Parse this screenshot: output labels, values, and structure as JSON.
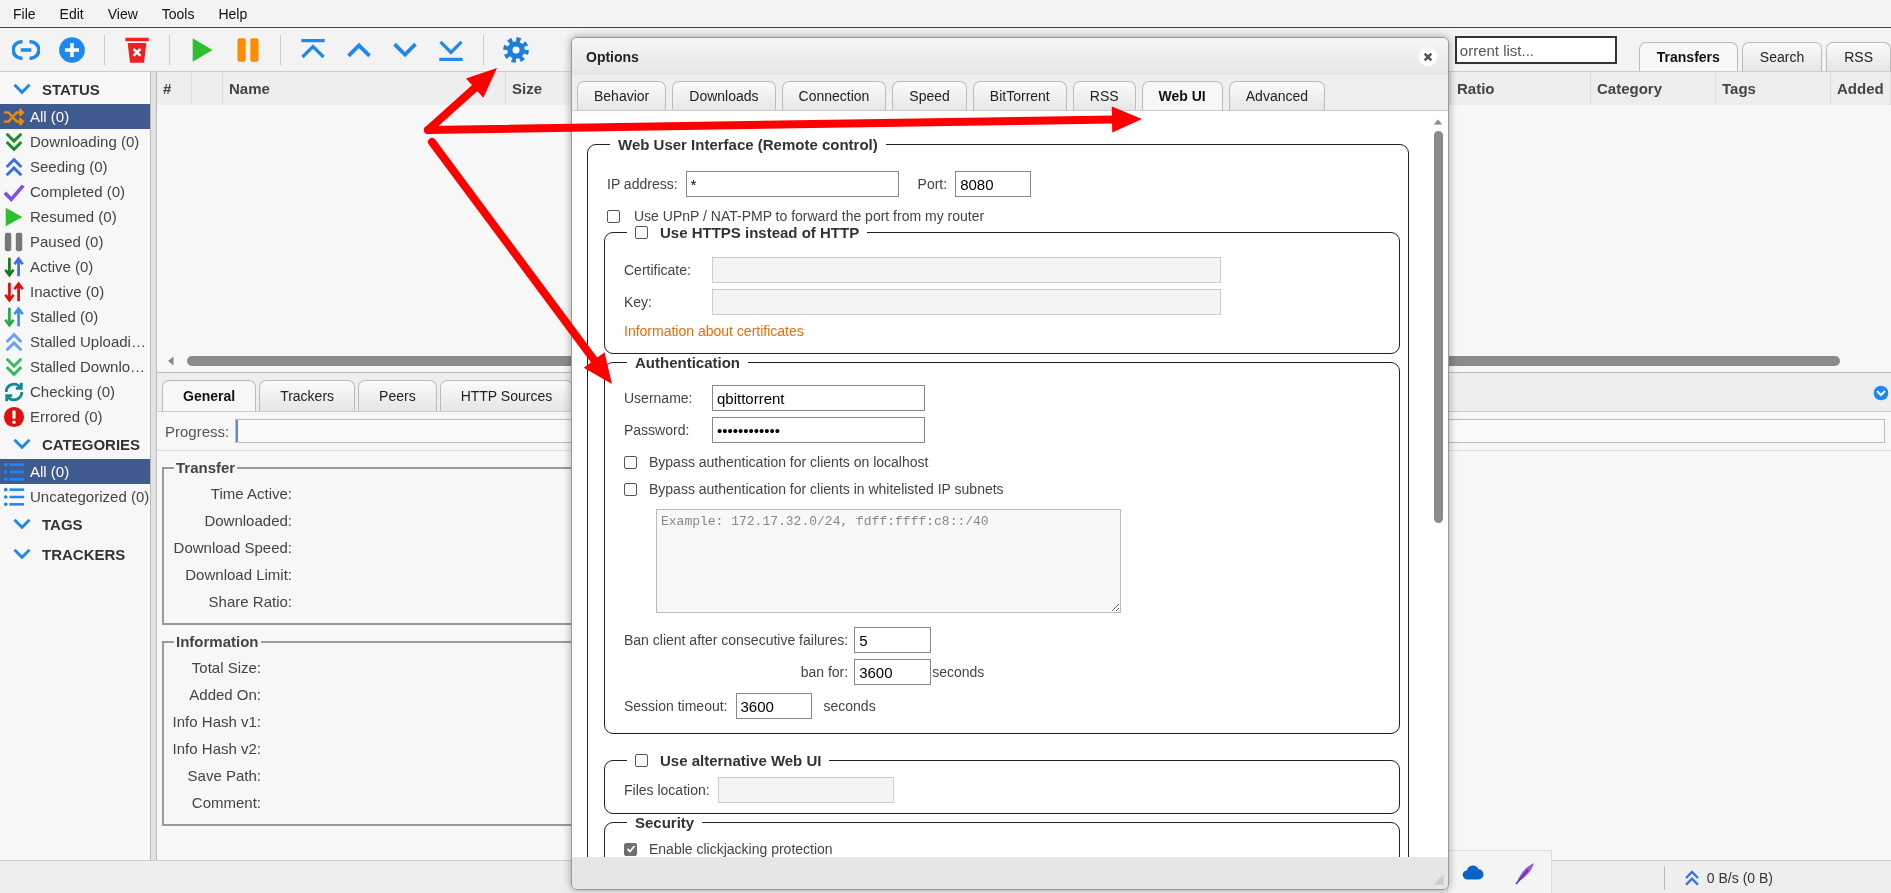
{
  "menu": [
    "File",
    "Edit",
    "View",
    "Tools",
    "Help"
  ],
  "search": {
    "placeholder": "orrent list..."
  },
  "main_tabs": [
    {
      "label": "Transfers",
      "selected": true
    },
    {
      "label": "Search",
      "selected": false
    },
    {
      "label": "RSS",
      "selected": false
    }
  ],
  "sidebar": {
    "sections": [
      {
        "title": "STATUS",
        "items": [
          {
            "label": "All (0)",
            "selected": true
          },
          {
            "label": "Downloading (0)",
            "selected": false
          },
          {
            "label": "Seeding (0)",
            "selected": false
          },
          {
            "label": "Completed (0)",
            "selected": false
          },
          {
            "label": "Resumed (0)",
            "selected": false
          },
          {
            "label": "Paused (0)",
            "selected": false
          },
          {
            "label": "Active (0)",
            "selected": false
          },
          {
            "label": "Inactive (0)",
            "selected": false
          },
          {
            "label": "Stalled (0)",
            "selected": false
          },
          {
            "label": "Stalled Uploadi…",
            "selected": false
          },
          {
            "label": "Stalled Downlo…",
            "selected": false
          },
          {
            "label": "Checking (0)",
            "selected": false
          },
          {
            "label": "Errored (0)",
            "selected": false
          }
        ]
      },
      {
        "title": "CATEGORIES",
        "items": [
          {
            "label": "All (0)",
            "selected": true
          },
          {
            "label": "Uncategorized (0)",
            "selected": false
          }
        ]
      },
      {
        "title": "TAGS"
      },
      {
        "title": "TRACKERS"
      }
    ]
  },
  "table": {
    "columns": [
      "#",
      "Name",
      "Size",
      "Ratio",
      "Category",
      "Tags",
      "Added"
    ]
  },
  "details": {
    "tabs": [
      {
        "label": "General",
        "selected": true
      },
      {
        "label": "Trackers",
        "selected": false
      },
      {
        "label": "Peers",
        "selected": false
      },
      {
        "label": "HTTP Sources",
        "selected": false
      }
    ],
    "progress_label": "Progress:",
    "progress": {
      "level": 0
    },
    "transfer": {
      "legend": "Transfer",
      "fields": [
        "Time Active:",
        "Downloaded:",
        "Download Speed:",
        "Download Limit:",
        "Share Ratio:"
      ]
    },
    "information": {
      "legend": "Information",
      "fields": [
        "Total Size:",
        "Added On:",
        "Info Hash v1:",
        "Info Hash v2:",
        "Save Path:",
        "Comment:"
      ]
    }
  },
  "status_bar": {
    "speed": "0 B/s (0 B)"
  },
  "options": {
    "title": "Options",
    "tabs": [
      {
        "label": "Behavior",
        "selected": false
      },
      {
        "label": "Downloads",
        "selected": false
      },
      {
        "label": "Connection",
        "selected": false
      },
      {
        "label": "Speed",
        "selected": false
      },
      {
        "label": "BitTorrent",
        "selected": false
      },
      {
        "label": "RSS",
        "selected": false
      },
      {
        "label": "Web UI",
        "selected": true
      },
      {
        "label": "Advanced",
        "selected": false
      }
    ],
    "web_ui": {
      "legend": "Web User Interface (Remote control)",
      "ip_label": "IP address:",
      "ip_value": "*",
      "port_label": "Port:",
      "port_value": "8080",
      "upnp": {
        "label": "Use UPnP / NAT-PMP to forward the port from my router",
        "checked": false
      },
      "https": {
        "label": "Use HTTPS instead of HTTP",
        "checked": false,
        "certificate_label": "Certificate:",
        "key_label": "Key:",
        "link": "Information about certificates"
      },
      "authentication": {
        "legend": "Authentication",
        "username_label": "Username:",
        "username": "qbittorrent",
        "password_label": "Password:",
        "password": "••••••••••••",
        "bypass": [
          {
            "label": "Bypass authentication for clients on localhost",
            "checked": false
          },
          {
            "label": "Bypass authentication for clients in whitelisted IP subnets",
            "checked": false
          }
        ],
        "subnets_placeholder": "Example: 172.17.32.0/24, fdff:ffff:c8::/40",
        "ban_after_label": "Ban client after consecutive failures:",
        "ban_after": "5",
        "ban_for_label": "ban for:",
        "ban_for": "3600",
        "ban_for_unit": "seconds",
        "session_timeout_label": "Session timeout:",
        "session_timeout": "3600",
        "session_timeout_unit": "seconds"
      },
      "alt_webui": {
        "label": "Use alternative Web UI",
        "checked": false,
        "files_location_label": "Files location:"
      },
      "security": {
        "legend": "Security",
        "options": [
          {
            "label": "Enable clickjacking protection",
            "checked": true
          }
        ]
      }
    }
  }
}
